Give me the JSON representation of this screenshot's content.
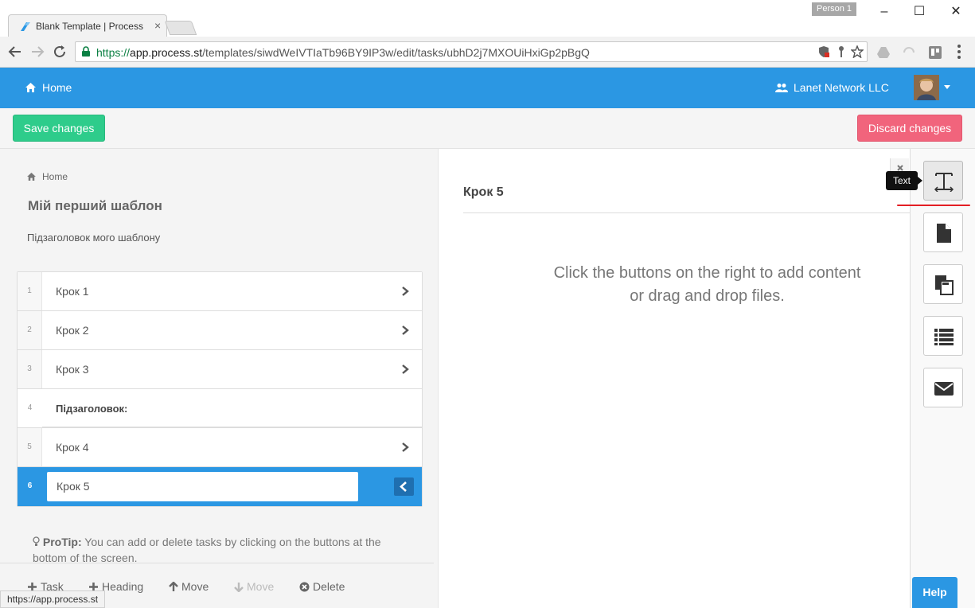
{
  "browser": {
    "tab_title": "Blank Template | Process",
    "profile": "Person 1",
    "url_scheme": "https://",
    "url_host": "app.process.st",
    "url_path": "/templates/siwdWeIVTIaTb96BY9IP3w/edit/tasks/ubhD2j7MXOUiHxiGp2pBgQ",
    "status_url": "https://app.process.st"
  },
  "nav": {
    "home": "Home",
    "org": "Lanet Network LLC"
  },
  "actions": {
    "save": "Save changes",
    "discard": "Discard changes"
  },
  "template": {
    "breadcrumb": "Home",
    "title": "Мій перший шаблон",
    "subtitle": "Підзаголовок мого шаблону"
  },
  "tasks": [
    {
      "num": "1",
      "name": "Крок 1",
      "type": "task"
    },
    {
      "num": "2",
      "name": "Крок 2",
      "type": "task"
    },
    {
      "num": "3",
      "name": "Крок 3",
      "type": "task"
    },
    {
      "num": "4",
      "name": "Підзаголовок:",
      "type": "heading"
    },
    {
      "num": "5",
      "name": "Крок 4",
      "type": "task"
    },
    {
      "num": "6",
      "name": "Крок 5",
      "type": "active"
    }
  ],
  "protip": {
    "label": "ProTip:",
    "text": " You can add or delete tasks by clicking on the buttons at the bottom of the screen."
  },
  "bottom_actions": {
    "task": "Task",
    "heading": "Heading",
    "move_up": "Move",
    "move_down": "Move",
    "delete": "Delete"
  },
  "editor": {
    "step_title": "Крок 5",
    "hint_line1": "Click the buttons on the right to add content",
    "hint_line2": "or drag and drop files."
  },
  "toolbar": {
    "tooltip": "Text",
    "help": "Help"
  },
  "colors": {
    "brand_blue": "#2b97e3",
    "save_green": "#2ecc8b",
    "discard_red": "#f1647c"
  }
}
